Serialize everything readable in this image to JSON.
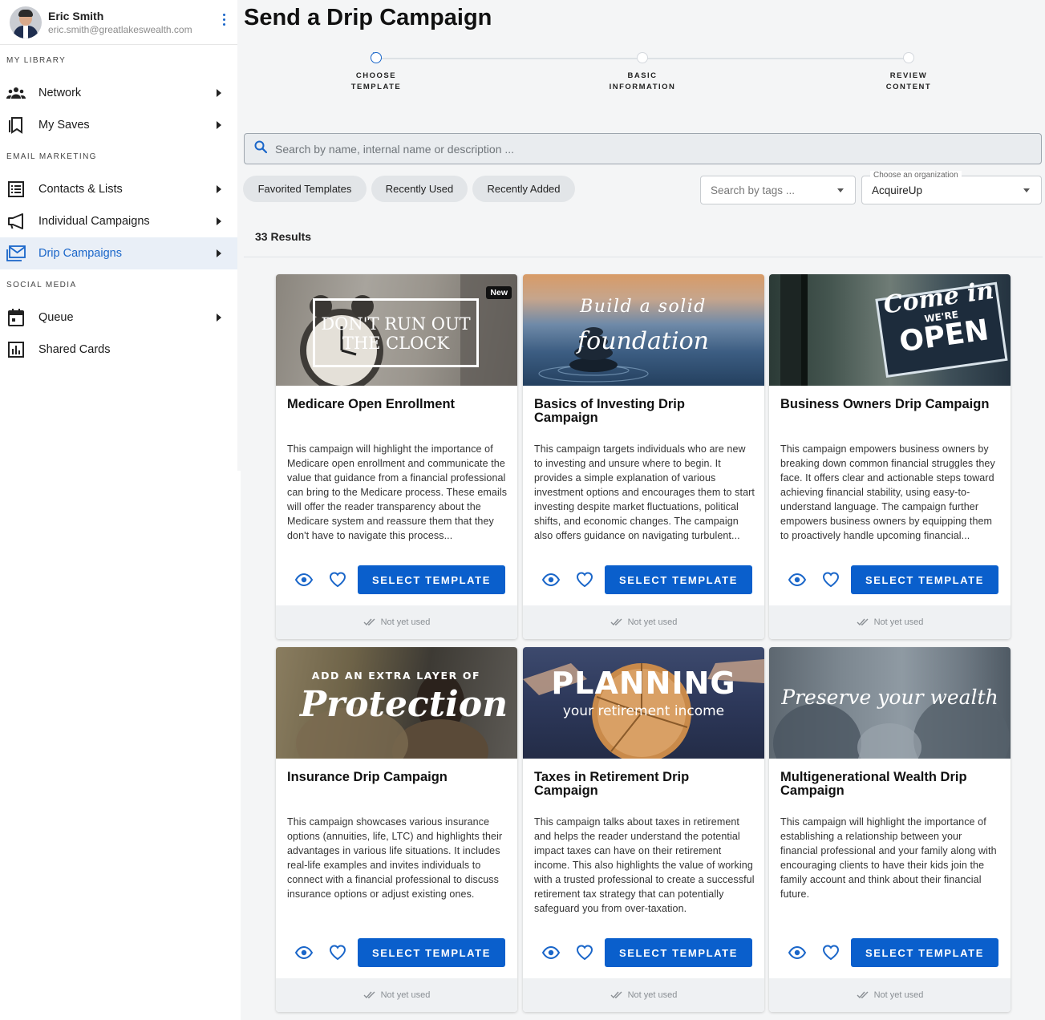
{
  "user": {
    "name": "Eric Smith",
    "email": "eric.smith@greatlakeswealth.com"
  },
  "sidebar": {
    "sections": [
      {
        "label": "MY LIBRARY",
        "items": [
          {
            "label": "Network",
            "icon": "people-icon"
          },
          {
            "label": "My Saves",
            "icon": "bookmark-icon"
          }
        ]
      },
      {
        "label": "EMAIL MARKETING",
        "items": [
          {
            "label": "Contacts & Lists",
            "icon": "list-icon"
          },
          {
            "label": "Individual Campaigns",
            "icon": "megaphone-icon"
          },
          {
            "label": "Drip Campaigns",
            "icon": "mail-stack-icon",
            "active": true
          }
        ]
      },
      {
        "label": "SOCIAL MEDIA",
        "items": [
          {
            "label": "Queue",
            "icon": "calendar-icon"
          },
          {
            "label": "Shared Cards",
            "icon": "chart-icon"
          }
        ]
      }
    ]
  },
  "page": {
    "title": "Send a Drip Campaign"
  },
  "stepper": {
    "steps": [
      {
        "line1": "CHOOSE",
        "line2": "TEMPLATE",
        "current": true
      },
      {
        "line1": "BASIC",
        "line2": "INFORMATION",
        "current": false
      },
      {
        "line1": "REVIEW",
        "line2": "CONTENT",
        "current": false
      }
    ]
  },
  "search": {
    "placeholder": "Search by name, internal name or description ..."
  },
  "filters": {
    "chips": [
      "Favorited Templates",
      "Recently Used",
      "Recently Added"
    ],
    "tags_placeholder": "Search by tags ...",
    "org_label": "Choose an organization",
    "org_value": "AcquireUp"
  },
  "results": {
    "count_label": "33 Results"
  },
  "cards": [
    {
      "title": "Medicare Open Enrollment",
      "description": "This campaign will highlight the importance of Medicare open enrollment and communicate the value that guidance from a financial professional can bring to the Medicare process. These emails will offer the reader transparency about the Medicare system and reassure them that they don't have to navigate this process...",
      "image_text": [
        "DON'T RUN OUT",
        "THE CLOCK"
      ],
      "badge": "New",
      "button": "SELECT TEMPLATE",
      "status": "Not yet used"
    },
    {
      "title": "Basics of Investing Drip Campaign",
      "description": "This campaign targets individuals who are new to investing and unsure where to begin. It provides a simple explanation of various investment options and encourages them to start investing despite market fluctuations, political shifts, and economic changes. The campaign also offers guidance on navigating turbulent...",
      "image_text": [
        "Build a solid",
        "foundation"
      ],
      "button": "SELECT TEMPLATE",
      "status": "Not yet used"
    },
    {
      "title": "Business Owners Drip Campaign",
      "description": "This campaign empowers business owners by breaking down common financial struggles they face. It offers clear and actionable steps toward achieving financial stability, using easy-to-understand language. The campaign further empowers business owners by equipping them to proactively handle upcoming financial...",
      "image_text": [
        "Come in",
        "WE'RE",
        "OPEN"
      ],
      "button": "SELECT TEMPLATE",
      "status": "Not yet used"
    },
    {
      "title": "Insurance Drip Campaign",
      "description": "This campaign showcases various insurance options (annuities, life, LTC) and highlights their advantages in various life situations. It includes real-life examples and invites individuals to connect with a financial professional to discuss insurance options or adjust existing ones.",
      "image_text": [
        "ADD AN EXTRA LAYER OF",
        "Protection"
      ],
      "button": "SELECT TEMPLATE",
      "status": "Not yet used"
    },
    {
      "title": "Taxes in Retirement Drip Campaign",
      "description": "This campaign talks about taxes in retirement and helps the reader understand the potential impact taxes can have on their retirement income. This also highlights the value of working with a trusted professional to create a successful retirement tax strategy that can potentially safeguard you from over-taxation.",
      "image_text": [
        "PLANNING",
        "your retirement income"
      ],
      "button": "SELECT TEMPLATE",
      "status": "Not yet used"
    },
    {
      "title": "Multigenerational Wealth Drip Campaign",
      "description": "This campaign will highlight the importance of establishing a relationship between your financial professional and your family along with encouraging clients to have their kids join the family account and think about their financial future.",
      "image_text": [
        "Preserve your wealth"
      ],
      "button": "SELECT TEMPLATE",
      "status": "Not yet used"
    }
  ],
  "colors": {
    "accent": "#0a5fcc",
    "active_bg": "#e9eff7",
    "page_bg": "#f4f5f6"
  }
}
